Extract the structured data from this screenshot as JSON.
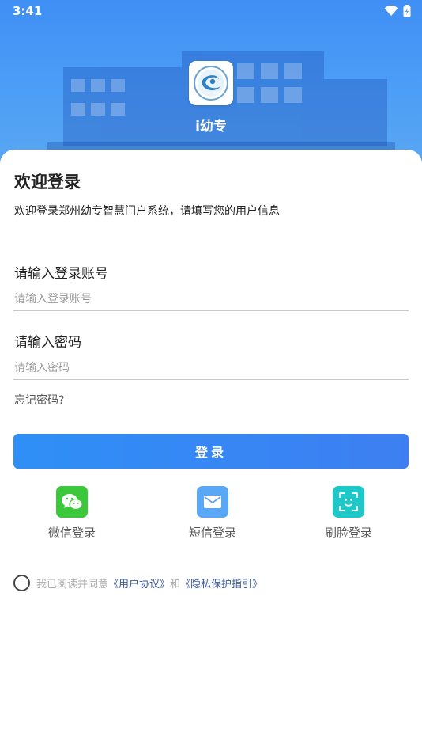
{
  "status_bar": {
    "time": "3:41"
  },
  "app": {
    "name": "i幼专"
  },
  "welcome": {
    "title": "欢迎登录",
    "subtitle": "欢迎登录郑州幼专智慧门户系统，请填写您的用户信息"
  },
  "account": {
    "label": "请输入登录账号",
    "placeholder": "请输入登录账号",
    "value": ""
  },
  "password": {
    "label": "请输入密码",
    "placeholder": "请输入密码",
    "value": ""
  },
  "forgot": "忘记密码?",
  "login_button": "登录",
  "alt_login": [
    {
      "label": "微信登录",
      "icon": "wechat-icon",
      "color": "#3cc83c"
    },
    {
      "label": "短信登录",
      "icon": "mail-icon",
      "color": "#5aa8f5"
    },
    {
      "label": "刷脸登录",
      "icon": "face-scan-icon",
      "color": "#1ec8c8"
    }
  ],
  "agreement": {
    "prefix": "我已阅读并同意",
    "user_agreement": "《用户协议》",
    "and": "和",
    "privacy": "《隐私保护指引》"
  },
  "colors": {
    "primary": "#2f8ff7",
    "link": "#3b5a9c"
  }
}
